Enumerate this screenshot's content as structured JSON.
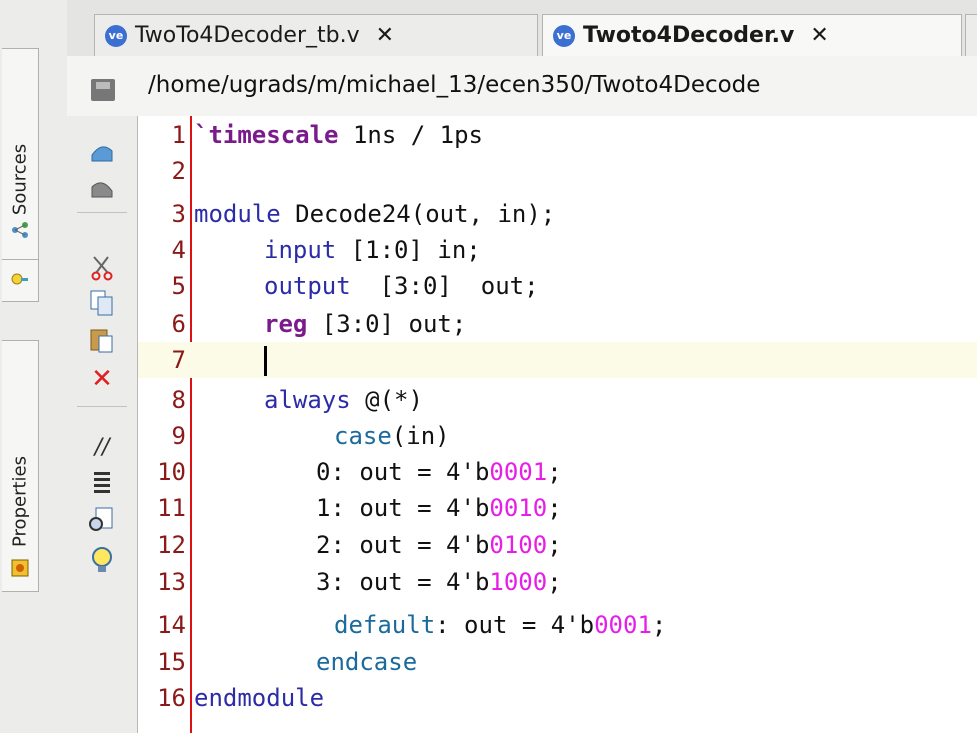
{
  "dock": {
    "sources_label": "Sources",
    "properties_label": "Properties"
  },
  "tabs": [
    {
      "icon": "ve",
      "label": "TwoTo4Decoder_tb.v",
      "close": "✕"
    },
    {
      "icon": "ve",
      "label": "Twoto4Decoder.v",
      "close": "✕"
    }
  ],
  "path": "/home/ugrads/m/michael_13/ecen350/Twoto4Decode",
  "code": {
    "l1_kw": "`timescale",
    "l1_rest": " 1ns / 1ps",
    "l3_kw": "module",
    "l3_rest": " Decode24(out, in);",
    "l4_kw": "input",
    "l4_rest": " [1:0] in;",
    "l5_kw": "output",
    "l5_rest": "  [3:0]  out;",
    "l6_kw": "reg",
    "l6_rest": " [3:0] out;",
    "l8_kw": "always",
    "l8_rest": " @(*)",
    "l9_kw": "case",
    "l9_rest": "(in)",
    "l10_pre": "0: out = 4'b",
    "l10_val": "0001",
    "l10_post": ";",
    "l11_pre": "1: out = 4'b",
    "l11_val": "0010",
    "l11_post": ";",
    "l12_pre": "2: out = 4'b",
    "l12_val": "0100",
    "l12_post": ";",
    "l13_pre": "3: out = 4'b",
    "l13_val": "1000",
    "l13_post": ";",
    "l14_kw": "default",
    "l14_pre": ": out = 4'b",
    "l14_val": "0001",
    "l14_post": ";",
    "l15_kw": "endcase",
    "l16_kw": "endmodule"
  },
  "line_numbers": [
    "1",
    "2",
    "3",
    "4",
    "5",
    "6",
    "7",
    "8",
    "9",
    "10",
    "11",
    "12",
    "13",
    "14",
    "15",
    "16"
  ],
  "colors": {
    "accent_keyword": "#7a1b8c",
    "binary_literal": "#e61ee6",
    "gutter_line": "#dd1111"
  }
}
